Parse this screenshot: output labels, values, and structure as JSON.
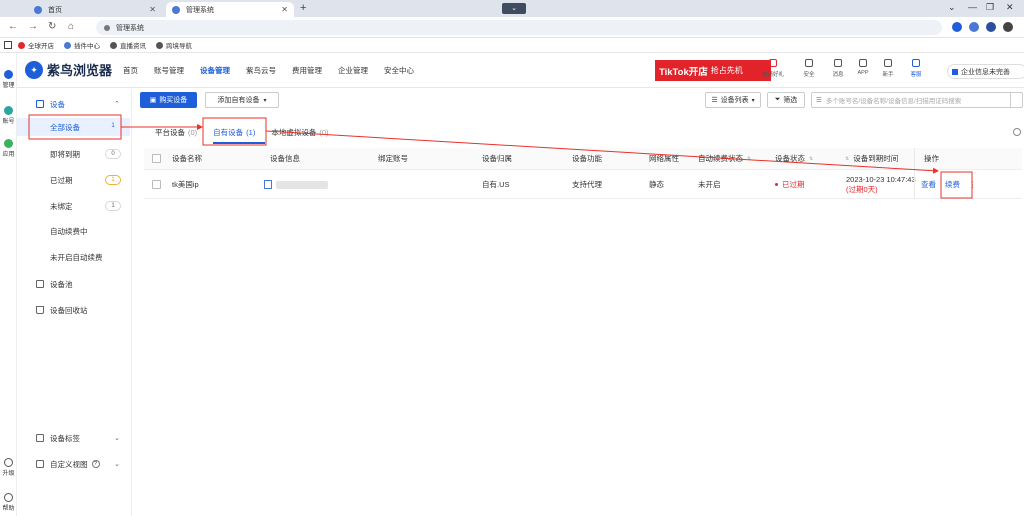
{
  "browser": {
    "tabs": [
      {
        "label": "首页",
        "active": false
      },
      {
        "label": "管理系统",
        "active": true
      }
    ],
    "new_tab_symbol": "+",
    "tab_dropdown_symbol": "⌄",
    "url": "管理系统",
    "bookmarks": [
      "全球开店",
      "插件中心",
      "直播资讯",
      "跨境导航"
    ]
  },
  "left_strip": {
    "top_items": [
      "管理",
      "账号",
      "应用"
    ],
    "bottom_items": [
      "升级",
      "帮助"
    ]
  },
  "app": {
    "brand_name": "紫鸟浏览器",
    "brand_color": "#1e5fd9",
    "nav": [
      {
        "label": "首页",
        "active": false
      },
      {
        "label": "账号管理",
        "active": false
      },
      {
        "label": "设备管理",
        "active": true
      },
      {
        "label": "紫鸟云号",
        "active": false
      },
      {
        "label": "费用管理",
        "active": false
      },
      {
        "label": "企业管理",
        "active": false
      },
      {
        "label": "安全中心",
        "active": false
      }
    ],
    "banner": {
      "main": "TikTok开店",
      "sub": "抢占先机",
      "color": "#e2232a"
    },
    "tools": [
      "邀请好礼",
      "安全",
      "消息",
      "APP",
      "新手",
      "客服"
    ],
    "company": "企业信息未完善"
  },
  "sidebar": {
    "section_device": "设备",
    "items": [
      {
        "label": "全部设备",
        "count": "1",
        "active": true
      },
      {
        "label": "即将到期",
        "count": "0",
        "active": false
      },
      {
        "label": "已过期",
        "count": "1",
        "active": false,
        "warn": true
      },
      {
        "label": "未绑定",
        "count": "1",
        "active": false
      },
      {
        "label": "自动续费中",
        "count": null,
        "active": false
      },
      {
        "label": "未开启自动续费",
        "count": null,
        "active": false
      }
    ],
    "device_pool": "设备池",
    "recycle_bin": "设备回收站",
    "device_tags": "设备标签",
    "custom_view": "自定义视图"
  },
  "toolbar": {
    "buy_device": "购买设备",
    "add_own_device": "添加自有设备",
    "device_list": "设备列表",
    "filter": "筛选",
    "search_placeholder": "多个账号名/设备名称/设备信息/扫描用证码搜索"
  },
  "subtabs": [
    {
      "label": "平台设备",
      "count": "(0)",
      "active": false
    },
    {
      "label": "自有设备",
      "count": "(1)",
      "active": true
    },
    {
      "label": "本地虚拟设备",
      "count": "(0)",
      "active": false
    }
  ],
  "table": {
    "headers": [
      "设备名称",
      "设备信息",
      "绑定账号",
      "设备归属",
      "设备功能",
      "网络属性",
      "自动续费状态",
      "设备状态",
      "设备到期时间",
      "操作"
    ],
    "rows": [
      {
        "name": "tk美国ip",
        "info": "",
        "bound_account": "",
        "ownership": "自有.US",
        "function": "支持代理",
        "network": "静态",
        "auto_renew": "未开启",
        "status": "已过期",
        "expire_time": "2023-10-23 10:47:43",
        "expire_note": "(过期0天)",
        "actions": [
          "查看",
          "续费"
        ],
        "more": "⋮"
      }
    ]
  },
  "annotation_color": "#e8312a"
}
